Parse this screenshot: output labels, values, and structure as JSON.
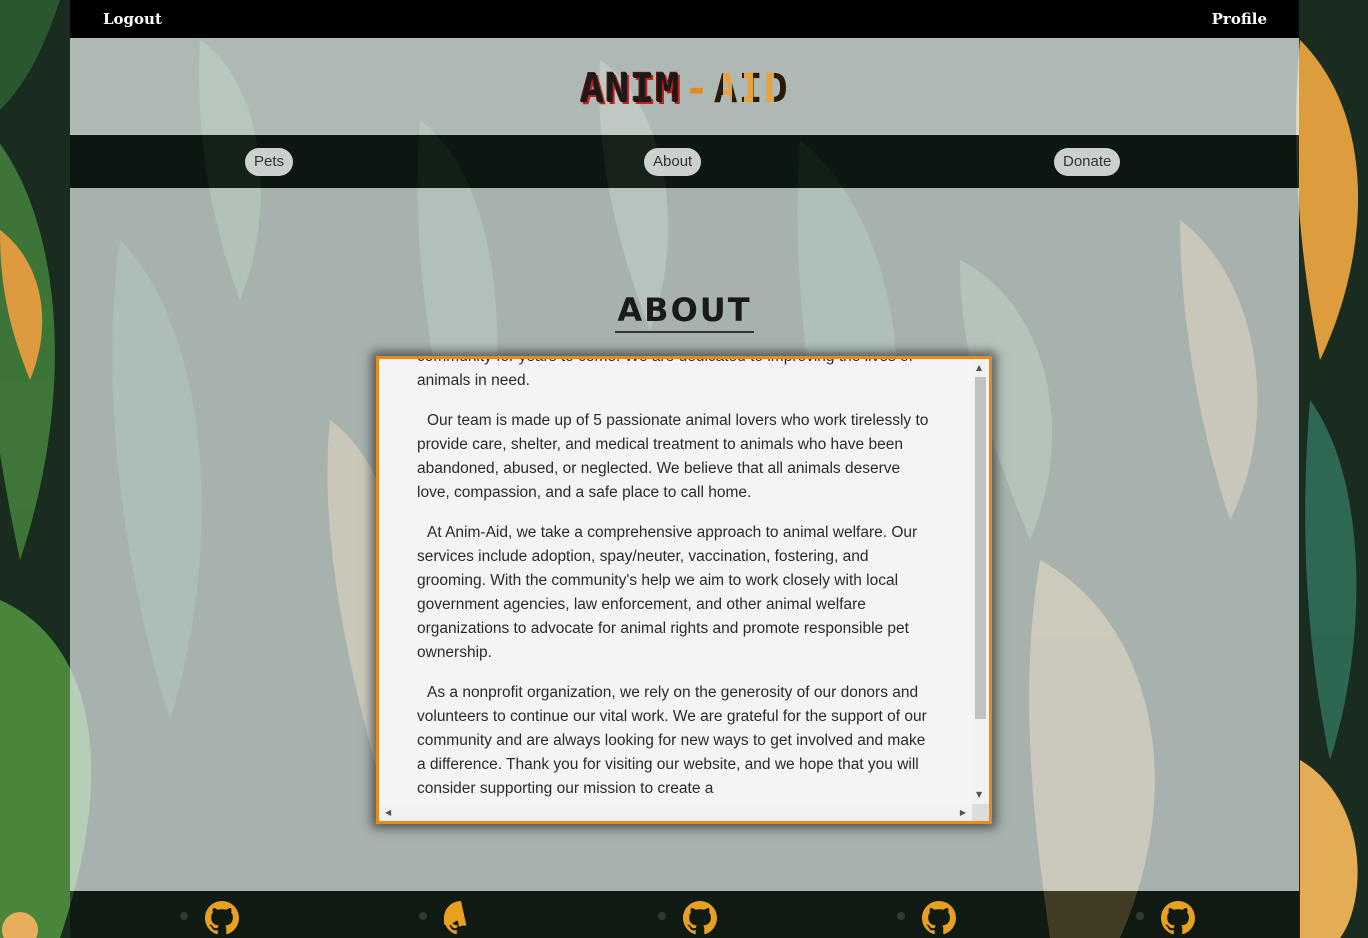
{
  "topbar": {
    "logout": "Logout",
    "profile": "Profile"
  },
  "brand": {
    "part1": "ANIM",
    "dash": "-",
    "part2": "AID"
  },
  "nav": {
    "pets": "Pets",
    "about": "About",
    "donate": "Donate"
  },
  "main": {
    "title": "ABOUT",
    "paragraphs": [
      "community for years to come. We are dedicated to improving the lives of animals in need.",
      "Our team is made up of 5 passionate animal lovers who work tirelessly to provide care, shelter, and medical treatment to animals who have been abandoned, abused, or neglected. We believe that all animals deserve love, compassion, and a safe place to call home.",
      "At Anim-Aid, we take a comprehensive approach to animal welfare. Our services include adoption, spay/neuter, vaccination, fostering, and grooming. With the community's help we aim to work closely with local government agencies, law enforcement, and other animal welfare organizations to advocate for animal rights and promote responsible pet ownership.",
      "As a nonprofit organization, we rely on the generosity of our donors and volunteers to continue our vital work. We are grateful for the support of our community and are always looking for new ways to get involved and make a difference. Thank you for visiting our website, and we hope that you will consider supporting our mission to create a"
    ]
  },
  "footer": {
    "icon": "github-icon",
    "icon_color": "#e8a020",
    "count": 5
  },
  "colors": {
    "accent": "#e8891c",
    "topbar": "#000000",
    "brand_shadow": "#c4201b"
  }
}
